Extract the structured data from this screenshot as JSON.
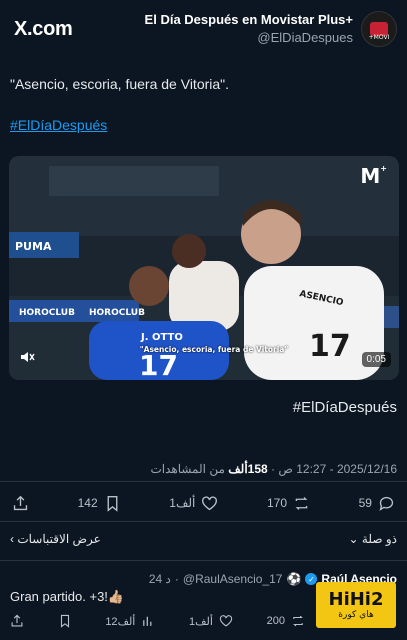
{
  "header": {
    "site_logo": "X.com",
    "author_name": "El Día Después en Movistar Plus+",
    "author_handle": "@ElDiaDespues",
    "avatar_label": "+MOVI"
  },
  "tweet": {
    "text": "\"Asencio, escoria, fuera de Vitoria\".",
    "hashtag": "#ElDíaDespués"
  },
  "media": {
    "channel_logo": "M",
    "channel_plus": "+",
    "caption": "\"Asencio, escoria, fuera de Vitoria\"",
    "duration": "0:05",
    "ad_boards": [
      "PUMA",
      "HOROCLUB",
      "HOROCLUB"
    ],
    "player_left_name": "J. OTTO",
    "player_left_number": "17",
    "player_right_name": "ASENCIO",
    "player_right_number": "17"
  },
  "hashtag_below": "#ElDíaDespués",
  "meta": {
    "date": "2025/12/16",
    "time": "12:27 ص",
    "views_count": "158ألف",
    "views_label": "من المشاهدات"
  },
  "actions": {
    "shares": "",
    "bookmarks": "142",
    "likes": "1ألف",
    "retweets": "170",
    "replies": "59"
  },
  "quote_row": {
    "left_label": "عرض الاقتباسات",
    "right_label": "ذو صلة"
  },
  "reply": {
    "name": "Raúl Asencio",
    "handle": "@RaulAsencio_17",
    "time": "24 د",
    "text": "Gran partido. +3!👍🏼",
    "views": "12ألف",
    "likes": "1ألف",
    "retweets": "200"
  },
  "watermark": {
    "brand": "HiHi2",
    "sub": "هاي كورة"
  },
  "colors": {
    "background": "#0c1622",
    "link": "#1d9bf0",
    "muted": "#9aa4ae"
  }
}
